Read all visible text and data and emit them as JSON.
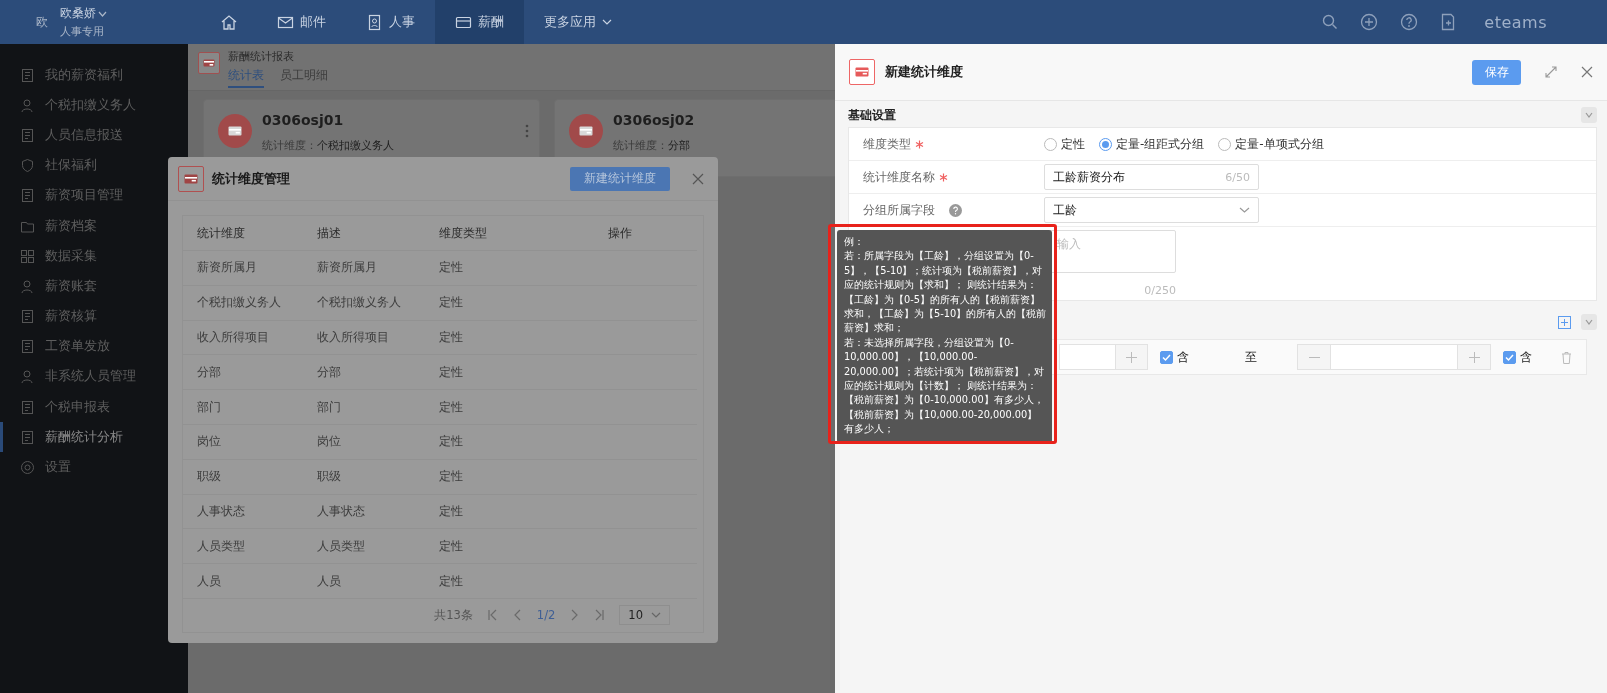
{
  "top_bar": {
    "user": {
      "avatar": "欧",
      "name": "欧桑娇",
      "role": "人事专用"
    },
    "nav": [
      {
        "kind": "home",
        "selected": false
      },
      {
        "kind": "mail",
        "label": "邮件",
        "selected": false
      },
      {
        "kind": "person",
        "label": "人事",
        "selected": false
      },
      {
        "kind": "card",
        "label": "薪酬",
        "selected": true
      },
      {
        "kind": "more",
        "label": "更多应用",
        "selected": false
      }
    ],
    "brand": "eteams"
  },
  "sidebar": {
    "items": [
      {
        "label": "我的薪资福利",
        "selected": false
      },
      {
        "label": "个税扣缴义务人",
        "selected": false
      },
      {
        "label": "人员信息报送",
        "selected": false
      },
      {
        "label": "社保福利",
        "selected": false
      },
      {
        "label": "薪资项目管理",
        "selected": false
      },
      {
        "label": "薪资档案",
        "selected": false
      },
      {
        "label": "数据采集",
        "selected": false
      },
      {
        "label": "薪资账套",
        "selected": false
      },
      {
        "label": "薪资核算",
        "selected": false
      },
      {
        "label": "工资单发放",
        "selected": false
      },
      {
        "label": "非系统人员管理",
        "selected": false
      },
      {
        "label": "个税申报表",
        "selected": false
      },
      {
        "label": "薪酬统计分析",
        "selected": true
      },
      {
        "label": "设置",
        "selected": false
      }
    ]
  },
  "page": {
    "title": "薪酬统计报表",
    "tabs": [
      {
        "label": "统计表",
        "selected": true
      },
      {
        "label": "员工明细",
        "selected": false
      }
    ],
    "cards": [
      {
        "name": "0306osj01",
        "dimension_label": "统计维度：",
        "dimension": "个税扣缴义务人"
      },
      {
        "name": "0306osj02",
        "dimension_label": "统计维度：",
        "dimension": "分部"
      }
    ]
  },
  "dimension_dialog": {
    "title": "统计维度管理",
    "new_button": "新建统计维度",
    "table": {
      "columns": [
        "统计维度",
        "描述",
        "维度类型",
        "操作"
      ],
      "rows": [
        [
          "薪资所属月",
          "薪资所属月",
          "定性"
        ],
        [
          "个税扣缴义务人",
          "个税扣缴义务人",
          "定性"
        ],
        [
          "收入所得项目",
          "收入所得项目",
          "定性"
        ],
        [
          "分部",
          "分部",
          "定性"
        ],
        [
          "部门",
          "部门",
          "定性"
        ],
        [
          "岗位",
          "岗位",
          "定性"
        ],
        [
          "职级",
          "职级",
          "定性"
        ],
        [
          "人事状态",
          "人事状态",
          "定性"
        ],
        [
          "人员类型",
          "人员类型",
          "定性"
        ],
        [
          "人员",
          "人员",
          "定性"
        ]
      ]
    },
    "pagination": {
      "total": "共13条",
      "page": "1/2",
      "page_size": "10"
    }
  },
  "new_dimension_panel": {
    "title": "新建统计维度",
    "save_button": "保存",
    "basic_section": {
      "title": "基础设置",
      "fields": [
        {
          "kind": "radio",
          "label": "维度类型",
          "required": true,
          "options": [
            {
              "label": "定性",
              "selected": false
            },
            {
              "label": "定量-组距式分组",
              "selected": true
            },
            {
              "label": "定量-单项式分组",
              "selected": false
            }
          ]
        },
        {
          "kind": "text",
          "label": "统计维度名称",
          "required": true,
          "value": "工龄薪资分布",
          "counter": "6/50"
        },
        {
          "kind": "select",
          "label": "分组所属字段",
          "required": false,
          "help": true,
          "value": "工龄"
        },
        {
          "kind": "textarea",
          "placeholder": "输入",
          "counter": "0/250"
        }
      ]
    },
    "group_section": {
      "ranges": [
        {
          "from_included": true,
          "from_include_label": "含",
          "to_label": "至",
          "to_included": true,
          "to_include_label": "含"
        }
      ]
    },
    "tooltip": {
      "paragraphs": [
        "例：",
        "若：所属字段为【工龄】，分组设置为【0-5】，【5-10】；统计项为【税前薪资】，对应的统计规则为【求和】； 则统计结果为：【工龄】为【0-5】的所有人的【税前薪资】求和，【工龄】为【5-10】的所有人的【税前薪资】求和；",
        "若：未选择所属字段，分组设置为【0-10,000.00】，【10,000.00-20,000.00】；若统计项为【税前薪资】，对应的统计规则为【计数】； 则统计结果为：【税前薪资】为【0-10,000.00】有多少人，【税前薪资】为【10,000.00-20,000.00】有多少人；"
      ]
    }
  }
}
